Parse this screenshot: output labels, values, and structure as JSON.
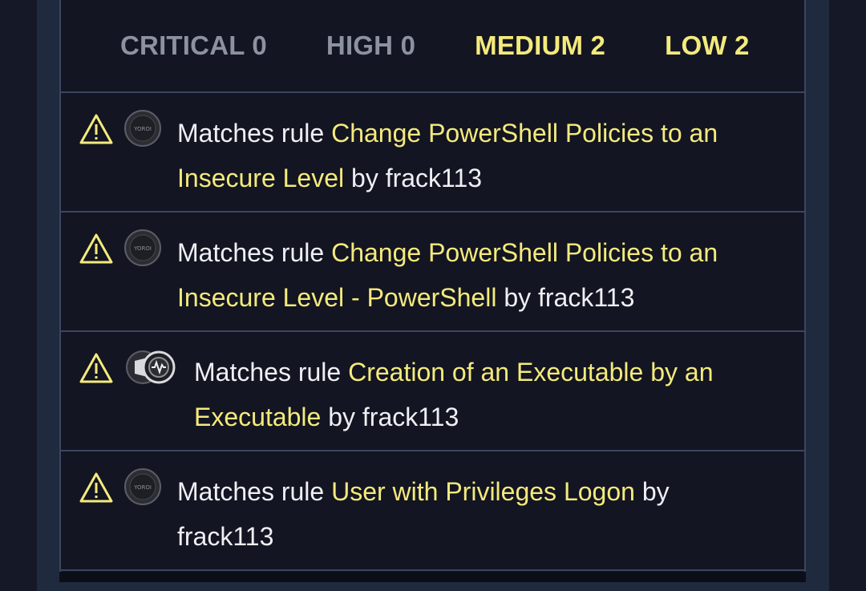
{
  "severity_tabs": [
    {
      "label": "CRITICAL 0",
      "active": false
    },
    {
      "label": "HIGH 0",
      "active": false
    },
    {
      "label": "MEDIUM 2",
      "active": true
    },
    {
      "label": "LOW 2",
      "active": true
    }
  ],
  "rules": [
    {
      "prefix": "Matches rule ",
      "rule_name": "Change PowerShell Policies to an Insecure Level",
      "suffix": " by frack113",
      "icon": "warning-icon",
      "badge": "yoroi-badge-icon",
      "badge_text": "YOROI"
    },
    {
      "prefix": "Matches rule ",
      "rule_name": "Change PowerShell Policies to an Insecure Level - PowerShell",
      "suffix": " by frack113",
      "icon": "warning-icon",
      "badge": "yoroi-badge-icon",
      "badge_text": "YOROI"
    },
    {
      "prefix": "Matches rule ",
      "rule_name": "Creation of an Executable by an Executable",
      "suffix": " by frack113",
      "icon": "warning-icon",
      "badge": "sandbox-badges-icon"
    },
    {
      "prefix": "Matches rule ",
      "rule_name": "User with Privileges Logon",
      "suffix": " by frack113",
      "icon": "warning-icon",
      "badge": "yoroi-badge-icon",
      "badge_text": "YOROI"
    }
  ],
  "colors": {
    "highlight": "#f4ea7c",
    "muted": "#8c92a0",
    "text": "#eef0f4",
    "background": "#131522",
    "border": "#3a4661"
  }
}
